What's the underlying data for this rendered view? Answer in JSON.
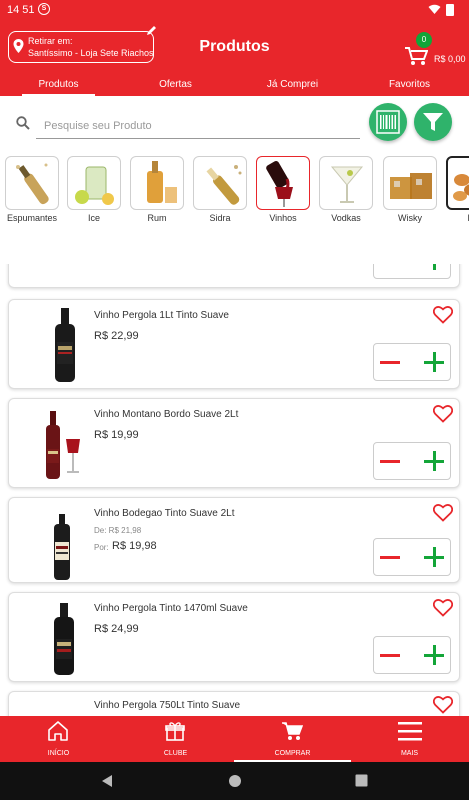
{
  "status_bar": {
    "time": "14 51",
    "notification_badge": "S"
  },
  "header": {
    "pickup_line1": "Retirar em:",
    "pickup_line2": "Santíssimo - Loja Sete Riachos",
    "title": "Produtos",
    "cart_count": "0",
    "cart_total": "R$ 0,00"
  },
  "tabs": [
    {
      "label": "Produtos",
      "active": true
    },
    {
      "label": "Ofertas"
    },
    {
      "label": "Já Comprei"
    },
    {
      "label": "Favoritos"
    }
  ],
  "search": {
    "placeholder": "Pesquise seu Produto"
  },
  "categories": [
    {
      "label": "Espumantes"
    },
    {
      "label": "Ice"
    },
    {
      "label": "Rum"
    },
    {
      "label": "Sidra"
    },
    {
      "label": "Vinhos",
      "selected": true
    },
    {
      "label": "Vodkas"
    },
    {
      "label": "Wisky"
    },
    {
      "label": "Pa"
    }
  ],
  "products": [
    {
      "name": "Vinho Pergola 1Lt Tinto Suave",
      "price": "R$ 22,99"
    },
    {
      "name": "Vinho Montano Bordo Suave 2Lt",
      "price": "R$ 19,99"
    },
    {
      "name": "Vinho Bodegao Tinto Suave 2Lt",
      "old_price": "De: R$ 21,98",
      "now_label": "Por:",
      "now_price": "R$ 19,98"
    },
    {
      "name": "Vinho Pergola Tinto 1470ml Suave",
      "price": "R$ 24,99"
    },
    {
      "name": "Vinho Pergola 750Lt Tinto Suave"
    }
  ],
  "bottom_nav": [
    {
      "label": "INÍCIO",
      "icon": "home-icon"
    },
    {
      "label": "CLUBE",
      "icon": "gift-icon"
    },
    {
      "label": "COMPRAR",
      "icon": "cart-icon",
      "active": true
    },
    {
      "label": "MAIS",
      "icon": "menu-icon"
    }
  ],
  "colors": {
    "brand_red": "#e8262b",
    "green": "#13a538",
    "round_button_green": "#2fb36b"
  }
}
